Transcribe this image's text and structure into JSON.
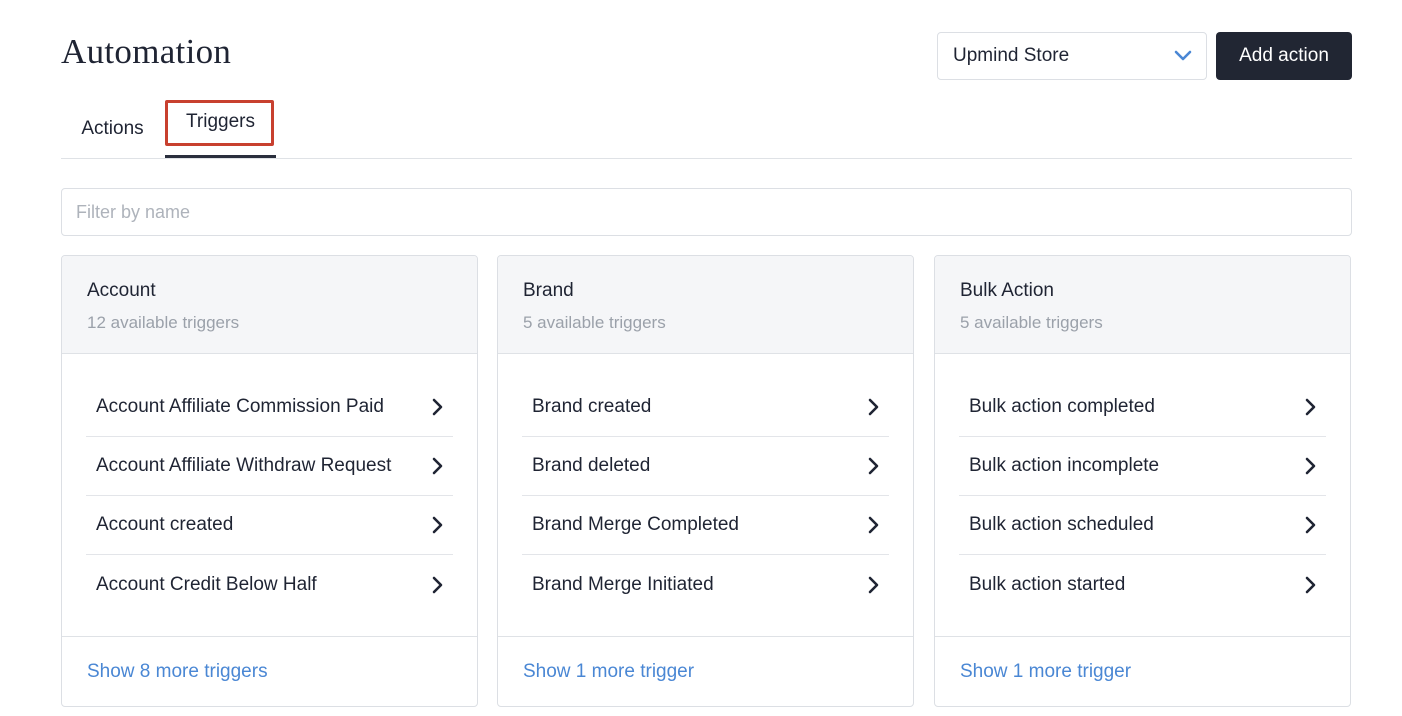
{
  "header": {
    "title": "Automation",
    "store_select": {
      "value": "Upmind Store",
      "icon": "chevron-down-icon"
    },
    "add_action_label": "Add action"
  },
  "tabs": [
    {
      "label": "Actions",
      "active": false
    },
    {
      "label": "Triggers",
      "active": true
    }
  ],
  "filter": {
    "placeholder": "Filter by name",
    "value": ""
  },
  "cards": [
    {
      "title": "Account",
      "subtitle": "12 available triggers",
      "items": [
        "Account Affiliate Commission Paid",
        "Account Affiliate Withdraw Request",
        "Account created",
        "Account Credit Below Half"
      ],
      "more_label": "Show 8 more triggers"
    },
    {
      "title": "Brand",
      "subtitle": "5 available triggers",
      "items": [
        "Brand created",
        "Brand deleted",
        "Brand Merge Completed",
        "Brand Merge Initiated"
      ],
      "more_label": "Show 1 more trigger"
    },
    {
      "title": "Bulk Action",
      "subtitle": "5 available triggers",
      "items": [
        "Bulk action completed",
        "Bulk action incomplete",
        "Bulk action scheduled",
        "Bulk action started"
      ],
      "more_label": "Show 1 more trigger"
    }
  ],
  "colors": {
    "primary_button": "#212633",
    "link": "#4a87d4",
    "active_tab_highlight": "#c8402f",
    "chevron": "#4a87d4"
  }
}
